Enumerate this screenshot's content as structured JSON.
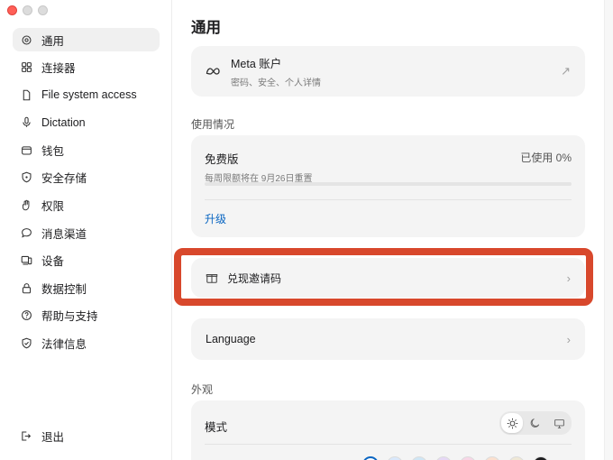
{
  "sidebar": {
    "items": [
      {
        "label": "通用",
        "icon": "gear-icon",
        "active": true
      },
      {
        "label": "连接器",
        "icon": "grid-icon"
      },
      {
        "label": "File system access",
        "icon": "file-icon"
      },
      {
        "label": "Dictation",
        "icon": "microphone-icon"
      },
      {
        "label": "钱包",
        "icon": "wallet-icon"
      },
      {
        "label": "安全存储",
        "icon": "shield-icon"
      },
      {
        "label": "权限",
        "icon": "hand-icon"
      },
      {
        "label": "消息渠道",
        "icon": "chat-bubble-icon"
      },
      {
        "label": "设备",
        "icon": "devices-icon"
      },
      {
        "label": "数据控制",
        "icon": "lock-icon"
      },
      {
        "label": "帮助与支持",
        "icon": "help-circle-icon"
      },
      {
        "label": "法律信息",
        "icon": "shield-check-icon"
      }
    ],
    "logout_label": "退出"
  },
  "main": {
    "title": "通用",
    "account": {
      "title": "Meta 账户",
      "subtitle": "密码、安全、个人详情"
    },
    "usage_label": "使用情况",
    "plan": {
      "name": "免费版",
      "reset_text": "每周限额将在 9月26日重置",
      "used_text": "已使用 0%",
      "used_fraction": 0,
      "upgrade_label": "升级"
    },
    "invite_label": "兑现邀请码",
    "language_label": "Language",
    "appearance_label": "外观",
    "mode_label": "模式",
    "mode_options": [
      "light",
      "dark",
      "system"
    ],
    "selected_mode": "light",
    "accent_colors": [
      "#ffffff",
      "#d9e8fb",
      "#cfe6f5",
      "#e6d8f5",
      "#f7d6e6",
      "#fbe0cf",
      "#efe8d6",
      "#1d1d1f"
    ]
  },
  "colors": {
    "accent": "#0a66c2",
    "highlight": "#d8482c"
  }
}
